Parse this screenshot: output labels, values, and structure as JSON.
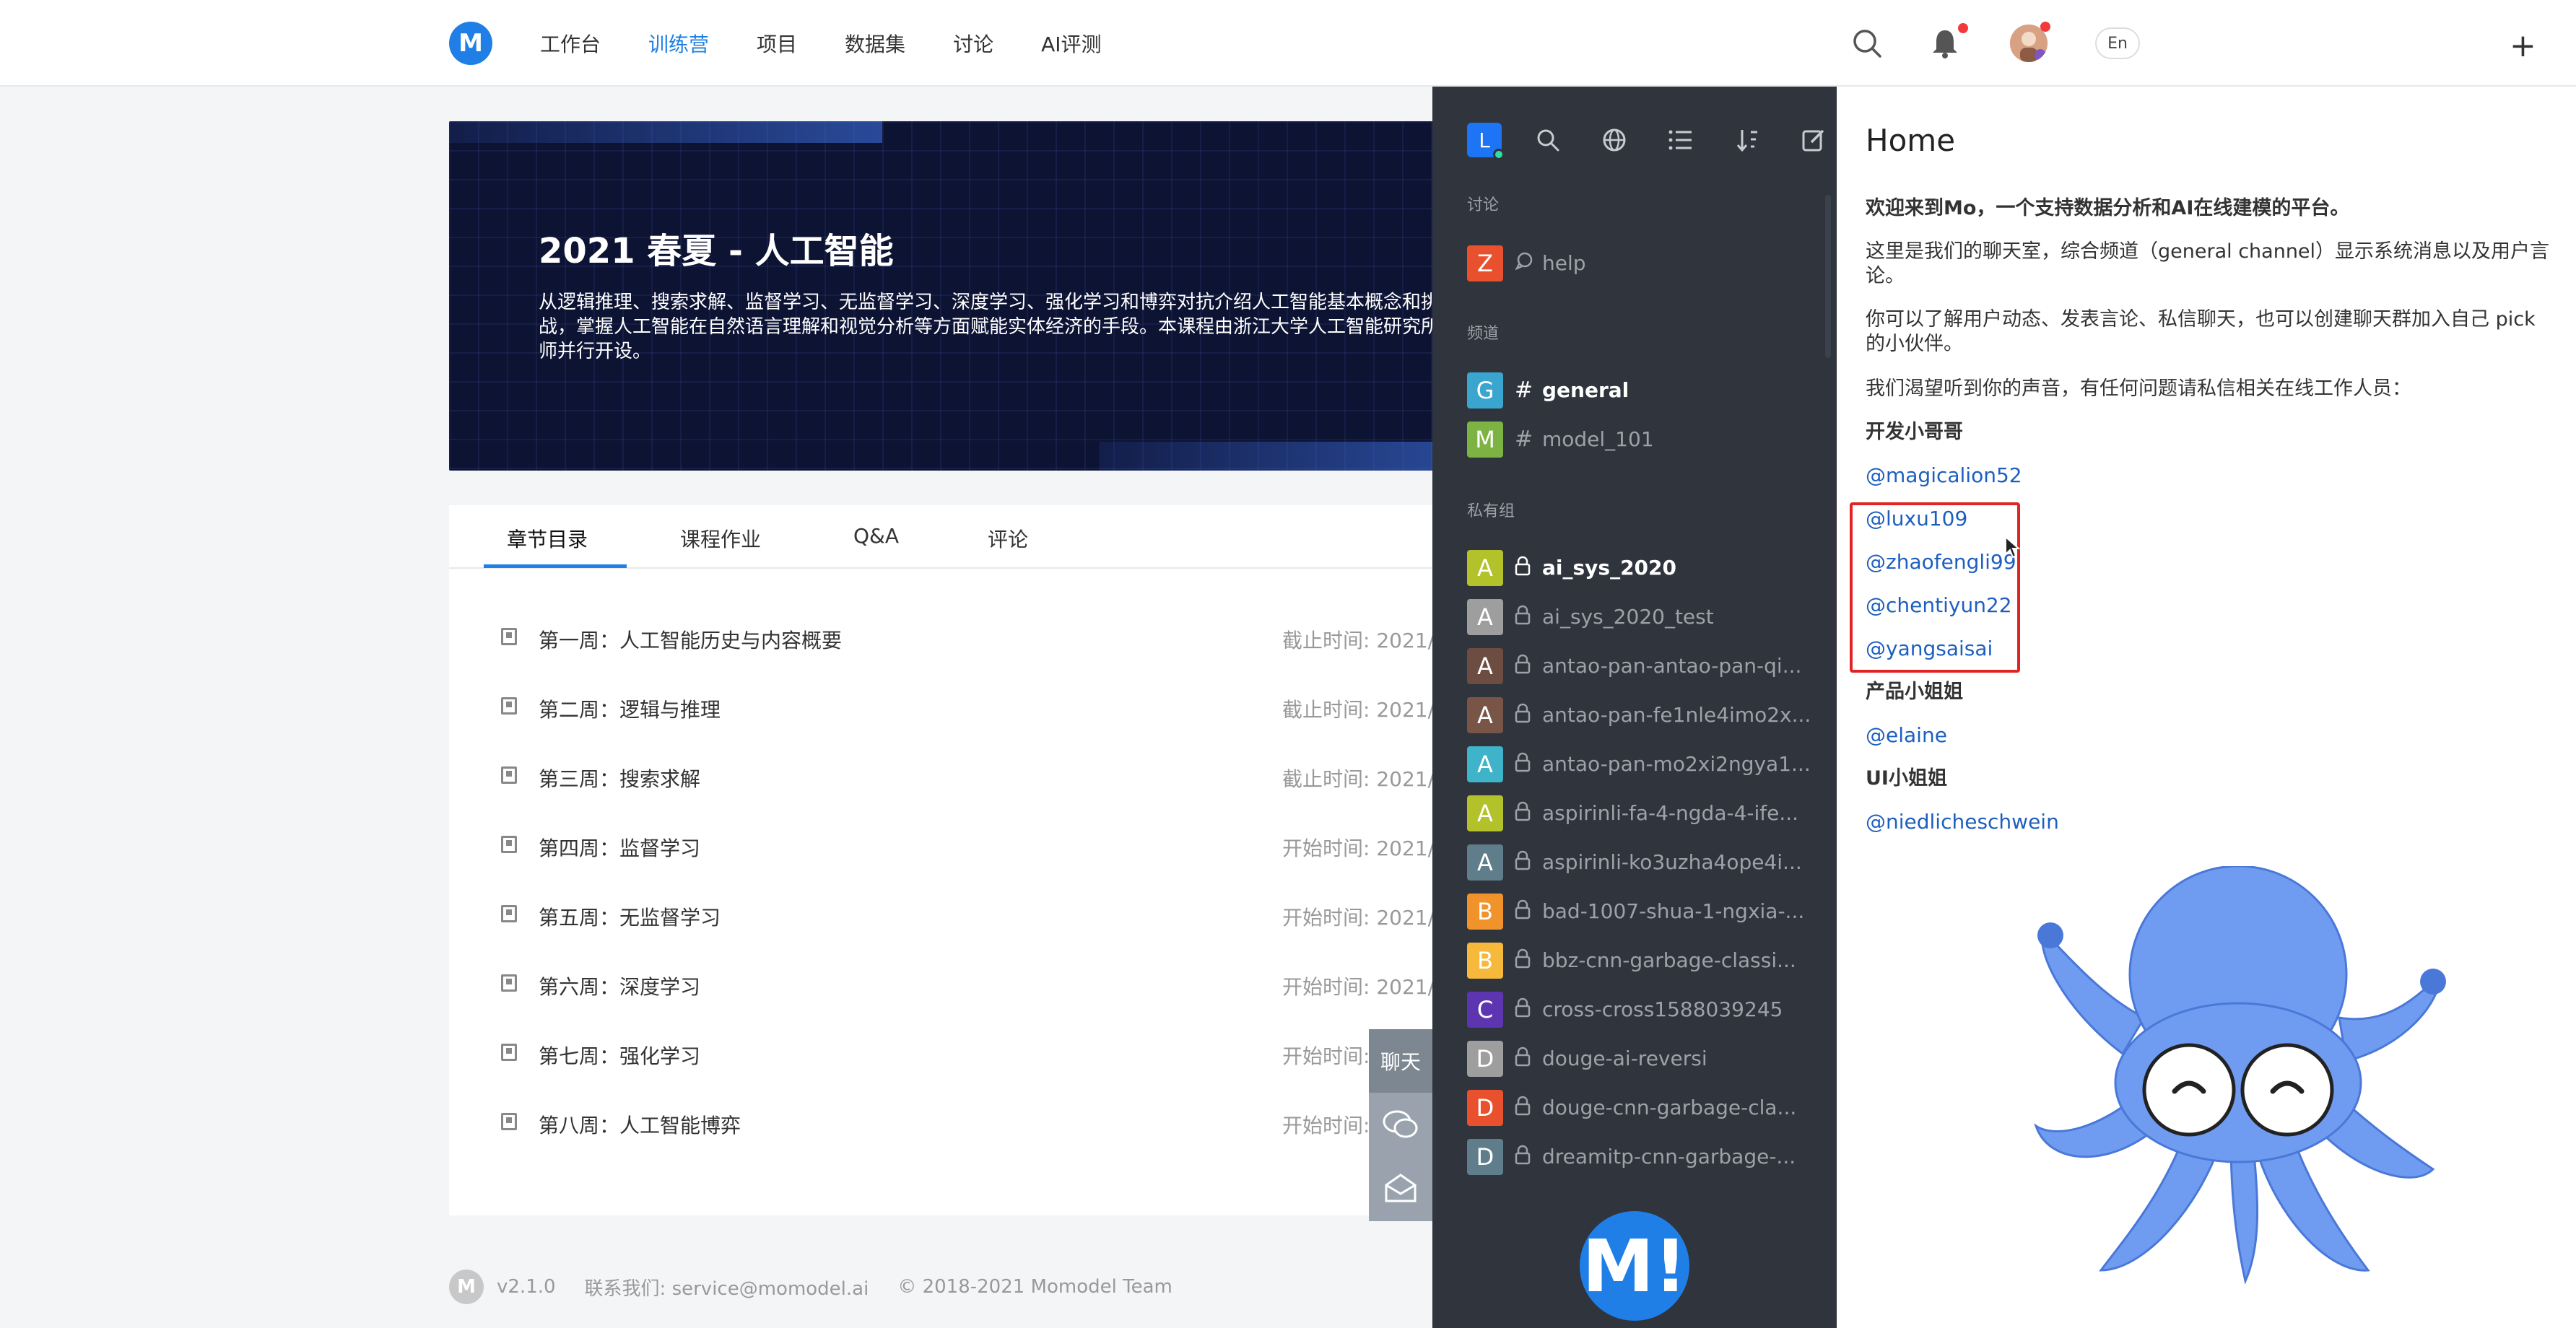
{
  "topnav": {
    "logo_text": "M",
    "items": [
      "工作台",
      "训练营",
      "项目",
      "数据集",
      "讨论",
      "AI评测"
    ],
    "active_index": 1,
    "lang_label": "En",
    "plus_label": "+"
  },
  "banner": {
    "title": "2021 春夏 - 人工智能",
    "description": "从逻辑推理、搜索求解、监督学习、无监督学习、深度学习、强化学习和博弈对抗介绍人工智能基本概念和挑战，掌握人工智能在自然语言理解和视觉分析等方面赋能实体经济的手段。本课程由浙江大学人工智能研究所教师并行开设。"
  },
  "course": {
    "tabs": [
      "章节目录",
      "课程作业",
      "Q&A",
      "评论"
    ],
    "active_tab": 0,
    "chapters": [
      {
        "title": "第一周：人工智能历史与内容概要",
        "time": "截止时间: 2021/"
      },
      {
        "title": "第二周：逻辑与推理",
        "time": "截止时间: 2021/"
      },
      {
        "title": "第三周：搜索求解",
        "time": "截止时间: 2021/"
      },
      {
        "title": "第四周：监督学习",
        "time": "开始时间: 2021/"
      },
      {
        "title": "第五周：无监督学习",
        "time": "开始时间: 2021/"
      },
      {
        "title": "第六周：深度学习",
        "time": "开始时间: 2021/"
      },
      {
        "title": "第七周：强化学习",
        "time": "开始时间:"
      },
      {
        "title": "第八周：人工智能博弈",
        "time": "开始时间:"
      }
    ]
  },
  "float_widget": {
    "chat_label": "聊天"
  },
  "footer": {
    "logo_text": "M",
    "version": "v2.1.0",
    "contact": "联系我们: service@momodel.ai",
    "copyright": "© 2018-2021 Momodel Team"
  },
  "chat_sidebar": {
    "user_initial": "L",
    "sections": {
      "discussion": "讨论",
      "channels": "频道",
      "private_groups": "私有组"
    },
    "discussions": [
      {
        "initial": "Z",
        "color": "#e9502d",
        "name": "help"
      }
    ],
    "channels": [
      {
        "initial": "G",
        "color": "#3aa6cf",
        "name": "general",
        "bold": true
      },
      {
        "initial": "M",
        "color": "#7cb342",
        "name": "model_101",
        "bold": false
      }
    ],
    "groups": [
      {
        "initial": "A",
        "color": "#b3c12a",
        "name": "ai_sys_2020",
        "bold": true
      },
      {
        "initial": "A",
        "color": "#9e9e9e",
        "name": "ai_sys_2020_test",
        "bold": false
      },
      {
        "initial": "A",
        "color": "#6d4c41",
        "name": "antao-pan-antao-pan-qi...",
        "bold": false
      },
      {
        "initial": "A",
        "color": "#795548",
        "name": "antao-pan-fe1nle4imo2x...",
        "bold": false
      },
      {
        "initial": "A",
        "color": "#3fb3c9",
        "name": "antao-pan-mo2xi2ngya1...",
        "bold": false
      },
      {
        "initial": "A",
        "color": "#b3c12a",
        "name": "aspirinli-fa-4-ngda-4-ife...",
        "bold": false
      },
      {
        "initial": "A",
        "color": "#607d8b",
        "name": "aspirinli-ko3uzha4ope4i...",
        "bold": false
      },
      {
        "initial": "B",
        "color": "#f0932b",
        "name": "bad-1007-shua-1-ngxia-...",
        "bold": false
      },
      {
        "initial": "B",
        "color": "#f6b93b",
        "name": "bbz-cnn-garbage-classi...",
        "bold": false
      },
      {
        "initial": "C",
        "color": "#5e35b1",
        "name": "cross-cross1588039245",
        "bold": false
      },
      {
        "initial": "D",
        "color": "#9e9e9e",
        "name": "douge-ai-reversi",
        "bold": false
      },
      {
        "initial": "D",
        "color": "#e9502d",
        "name": "douge-cnn-garbage-cla...",
        "bold": false
      },
      {
        "initial": "D",
        "color": "#607d8b",
        "name": "dreamitp-cnn-garbage-...",
        "bold": false
      }
    ],
    "bottom_logo": "M!"
  },
  "chat_home": {
    "title": "Home",
    "welcome": "欢迎来到Mo，一个支持数据分析和AI在线建模的平台。",
    "p1": "这里是我们的聊天室，综合频道（general channel）显示系统消息以及用户言论。",
    "p2": "你可以了解用户动态、发表言论、私信聊天，也可以创建聊天群加入自己 pick 的小伙伴。",
    "p3": "我们渴望听到你的声音，有任何问题请私信相关在线工作人员：",
    "dev_heading": "开发小哥哥",
    "dev_links": [
      "@magicalion52",
      "@luxu109",
      "@zhaofengli99",
      "@chentiyun22",
      "@yangsaisai"
    ],
    "product_heading": "产品小姐姐",
    "product_links": [
      "@elaine"
    ],
    "ui_heading": "UI小姐姐",
    "ui_links": [
      "@niedlicheschwein"
    ]
  },
  "colors": {
    "accent": "#1f7fe6",
    "sidebar_bg": "#2f343d",
    "link": "#1d5fbf",
    "highlight": "#e02424",
    "notification_dot": "#f23a3a"
  }
}
